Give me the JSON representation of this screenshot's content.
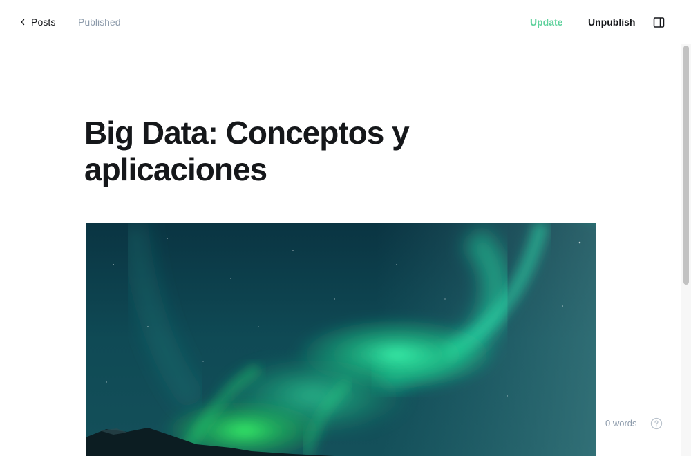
{
  "header": {
    "back_label": "Posts",
    "status": "Published",
    "update_label": "Update",
    "unpublish_label": "Unpublish"
  },
  "post": {
    "title": "Big Data: Conceptos y aplicaciones"
  },
  "footer": {
    "word_count": "0 words"
  },
  "icons": {
    "back": "chevron-left-icon",
    "sidebar": "sidebar-toggle-icon",
    "help": "question-circle-icon"
  },
  "colors": {
    "accent_green": "#5ed19c",
    "muted_text": "#8e9cac",
    "text": "#15171a"
  }
}
